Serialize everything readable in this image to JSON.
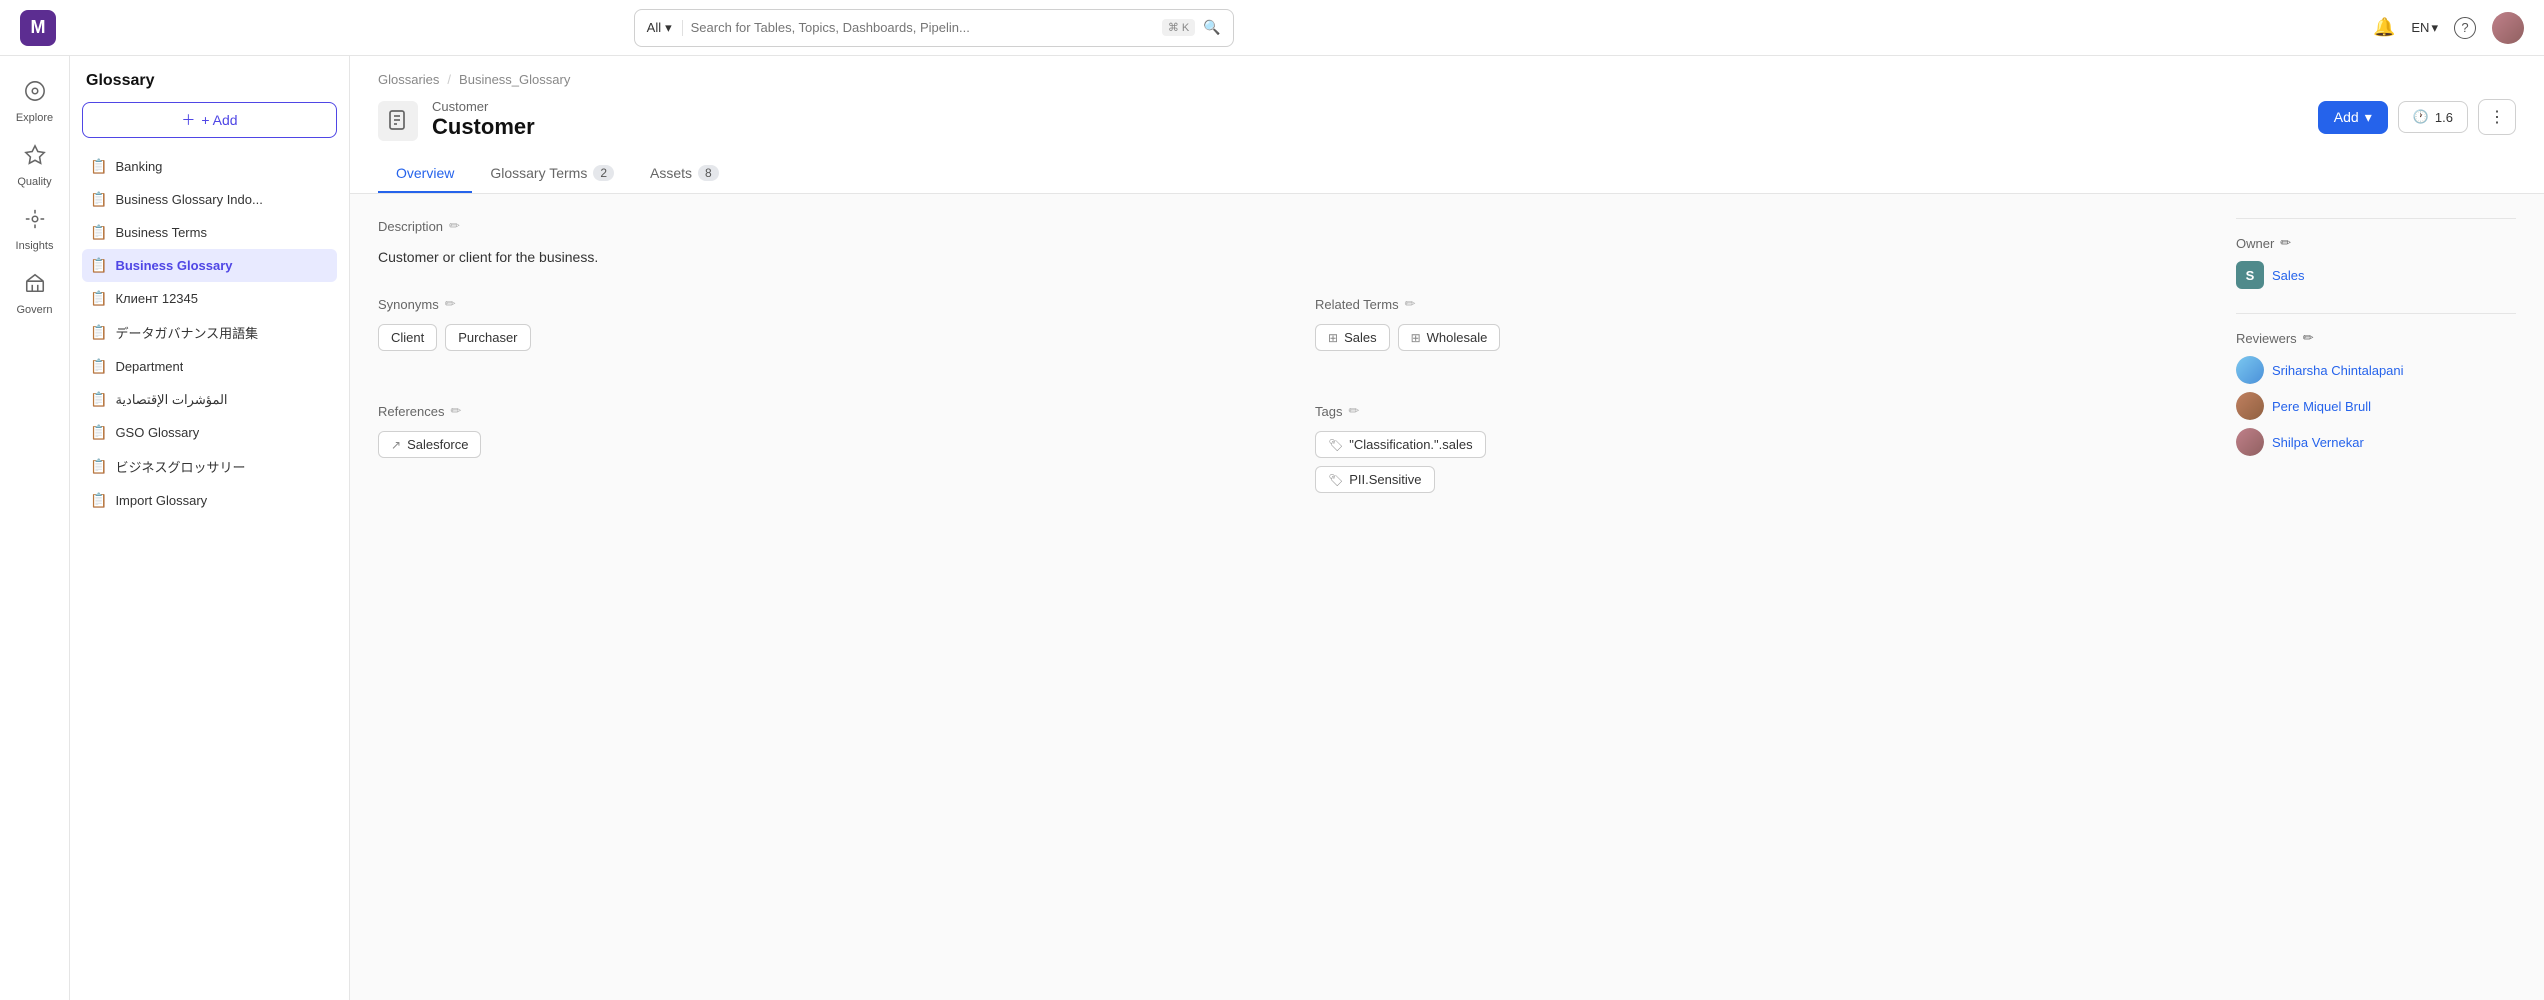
{
  "app": {
    "logo": "M"
  },
  "topbar": {
    "search_placeholder": "Search for Tables, Topics, Dashboards, Pipelin...",
    "search_all_label": "All",
    "search_kbd": [
      "⌘",
      "K"
    ],
    "lang": "EN",
    "help": "?"
  },
  "icon_nav": [
    {
      "id": "explore",
      "icon": "🌐",
      "label": "Explore"
    },
    {
      "id": "quality",
      "icon": "⭐",
      "label": "Quality"
    },
    {
      "id": "insights",
      "icon": "💡",
      "label": "Insights"
    },
    {
      "id": "govern",
      "icon": "🏛",
      "label": "Govern"
    }
  ],
  "glossary_sidebar": {
    "title": "Glossary",
    "add_label": "+ Add",
    "items": [
      {
        "id": "banking",
        "label": "Banking"
      },
      {
        "id": "business-glossary-indo",
        "label": "Business Glossary Indo..."
      },
      {
        "id": "business-terms",
        "label": "Business Terms"
      },
      {
        "id": "business-glossary",
        "label": "Business Glossary",
        "active": true
      },
      {
        "id": "client-12345",
        "label": "Клиент 12345"
      },
      {
        "id": "data-governance-jp",
        "label": "データガバナンス用語集"
      },
      {
        "id": "department",
        "label": "Department"
      },
      {
        "id": "arabic-indicators",
        "label": "المؤشرات الإقتصادية"
      },
      {
        "id": "gso-glossary",
        "label": "GSO Glossary"
      },
      {
        "id": "business-glossary-jp",
        "label": "ビジネスグロッサリー"
      },
      {
        "id": "import-glossary",
        "label": "Import Glossary"
      }
    ]
  },
  "breadcrumb": {
    "parts": [
      "Glossaries",
      "Business_Glossary"
    ]
  },
  "page": {
    "subtitle": "Customer",
    "title": "Customer",
    "version": "1.6",
    "add_label": "Add",
    "tabs": [
      {
        "id": "overview",
        "label": "Overview",
        "badge": null
      },
      {
        "id": "glossary-terms",
        "label": "Glossary Terms",
        "badge": "2"
      },
      {
        "id": "assets",
        "label": "Assets",
        "badge": "8"
      }
    ],
    "active_tab": "overview"
  },
  "overview": {
    "description": {
      "label": "Description",
      "text": "Customer or client for the business."
    },
    "synonyms": {
      "label": "Synonyms",
      "items": [
        "Client",
        "Purchaser"
      ]
    },
    "related_terms": {
      "label": "Related Terms",
      "items": [
        "Sales",
        "Wholesale"
      ]
    },
    "references": {
      "label": "References",
      "items": [
        "Salesforce"
      ]
    },
    "tags": {
      "label": "Tags",
      "items": [
        "\"Classification.\".sales",
        "PII.Sensitive"
      ]
    }
  },
  "right_panel": {
    "owner": {
      "label": "Owner",
      "name": "Sales",
      "avatar_letter": "S",
      "avatar_color": "#4f8a8b"
    },
    "reviewers": {
      "label": "Reviewers",
      "items": [
        {
          "name": "Sriharsha Chintalapani"
        },
        {
          "name": "Pere Miquel Brull"
        },
        {
          "name": "Shilpa Vernekar"
        }
      ]
    }
  },
  "icons": {
    "document": "📄",
    "edit": "✏",
    "chevron_down": "▾",
    "clock": "🕐",
    "more": "⋮",
    "external_link": "↗",
    "tag": "🏷",
    "bell": "🔔",
    "question": "?",
    "search": "🔍",
    "plus": "+"
  }
}
